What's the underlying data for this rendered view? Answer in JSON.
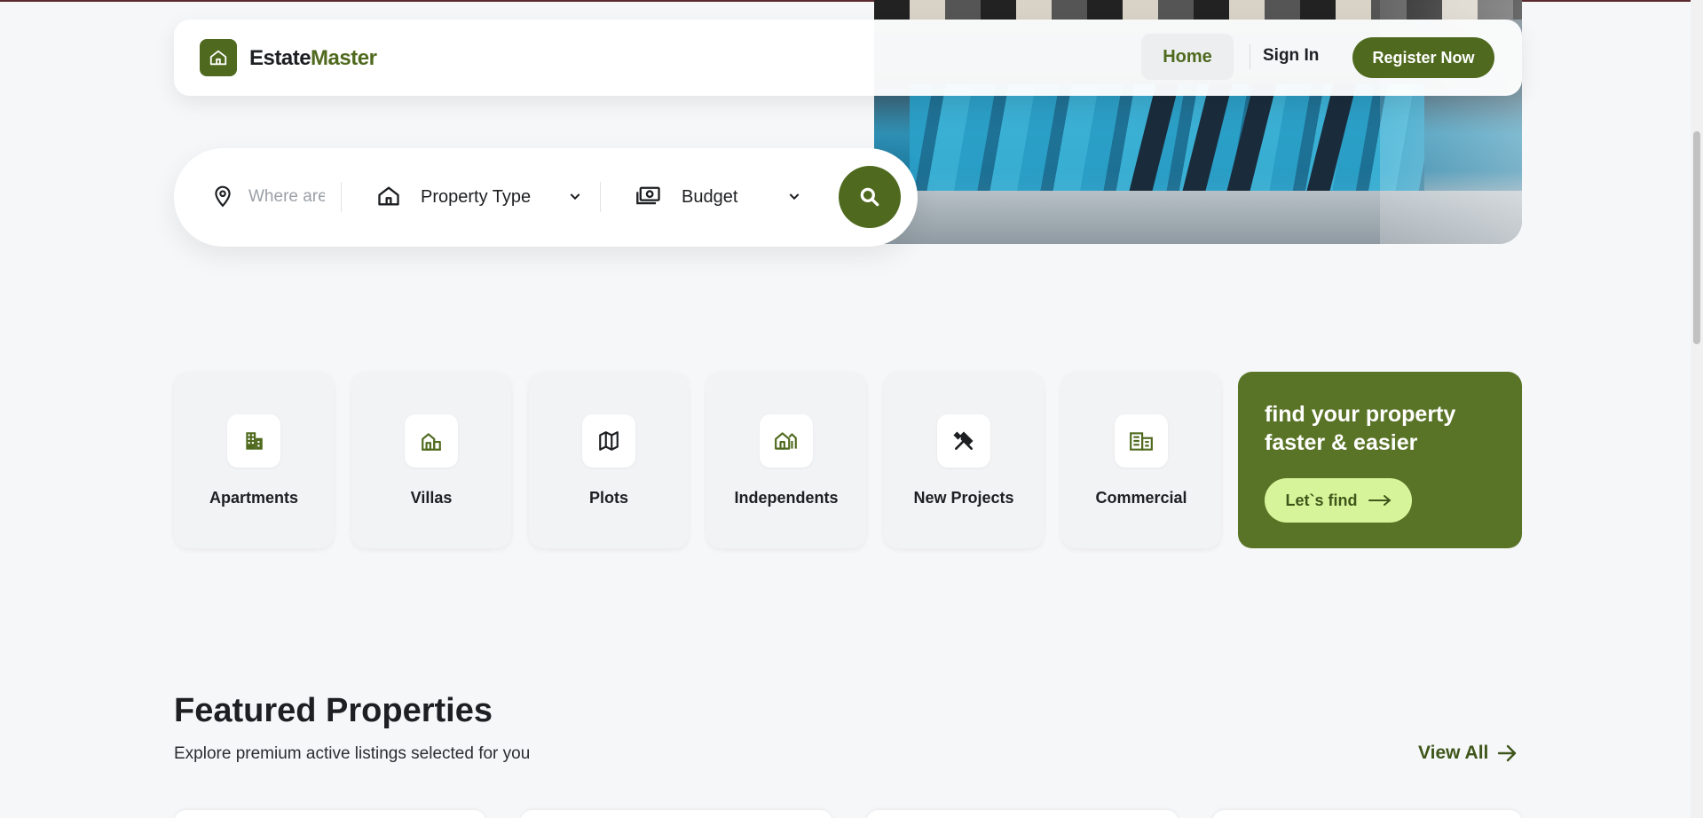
{
  "nav": {
    "brand_part1": "Estate",
    "brand_part2": "Master",
    "home": "Home",
    "sign_in": "Sign In",
    "register": "Register Now"
  },
  "search": {
    "location_placeholder": "Where are you looking?",
    "property_type": "Property Type",
    "budget": "Budget"
  },
  "categories": [
    {
      "label": "Apartments",
      "icon": "apartment-icon"
    },
    {
      "label": "Villas",
      "icon": "villa-icon"
    },
    {
      "label": "Plots",
      "icon": "map-icon"
    },
    {
      "label": "Independents",
      "icon": "house-icon"
    },
    {
      "label": "New Projects",
      "icon": "tools-icon"
    },
    {
      "label": "Commercial",
      "icon": "office-icon"
    }
  ],
  "promo": {
    "title": "find your property faster & easier",
    "button": "Let`s find"
  },
  "featured": {
    "title": "Featured Properties",
    "subtitle": "Explore premium active listings selected for you",
    "view_all": "View All"
  },
  "colors": {
    "accent": "#4f6a1e",
    "promo_bg": "#5a7427",
    "promo_button": "#d6f59a"
  }
}
